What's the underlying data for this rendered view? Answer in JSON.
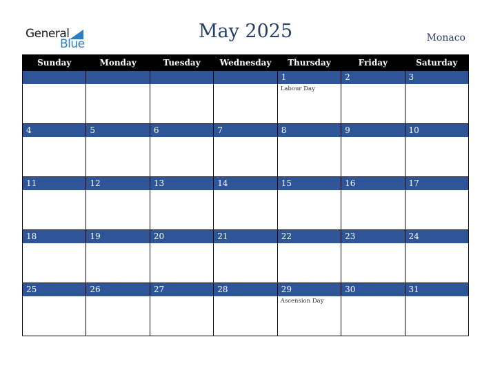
{
  "logo": {
    "word1": "General",
    "word2": "Blue"
  },
  "header": {
    "title": "May 2025",
    "country": "Monaco"
  },
  "colors": {
    "accent": "#2e5597",
    "header_bg": "#000000",
    "title": "#253f6b",
    "logo_blue": "#2a7ec3"
  },
  "weekdays": [
    "Sunday",
    "Monday",
    "Tuesday",
    "Wednesday",
    "Thursday",
    "Friday",
    "Saturday"
  ],
  "weeks": [
    [
      {
        "day": "",
        "holiday": ""
      },
      {
        "day": "",
        "holiday": ""
      },
      {
        "day": "",
        "holiday": ""
      },
      {
        "day": "",
        "holiday": ""
      },
      {
        "day": "1",
        "holiday": "Labour Day"
      },
      {
        "day": "2",
        "holiday": ""
      },
      {
        "day": "3",
        "holiday": ""
      }
    ],
    [
      {
        "day": "4",
        "holiday": ""
      },
      {
        "day": "5",
        "holiday": ""
      },
      {
        "day": "6",
        "holiday": ""
      },
      {
        "day": "7",
        "holiday": ""
      },
      {
        "day": "8",
        "holiday": ""
      },
      {
        "day": "9",
        "holiday": ""
      },
      {
        "day": "10",
        "holiday": ""
      }
    ],
    [
      {
        "day": "11",
        "holiday": ""
      },
      {
        "day": "12",
        "holiday": ""
      },
      {
        "day": "13",
        "holiday": ""
      },
      {
        "day": "14",
        "holiday": ""
      },
      {
        "day": "15",
        "holiday": ""
      },
      {
        "day": "16",
        "holiday": ""
      },
      {
        "day": "17",
        "holiday": ""
      }
    ],
    [
      {
        "day": "18",
        "holiday": ""
      },
      {
        "day": "19",
        "holiday": ""
      },
      {
        "day": "20",
        "holiday": ""
      },
      {
        "day": "21",
        "holiday": ""
      },
      {
        "day": "22",
        "holiday": ""
      },
      {
        "day": "23",
        "holiday": ""
      },
      {
        "day": "24",
        "holiday": ""
      }
    ],
    [
      {
        "day": "25",
        "holiday": ""
      },
      {
        "day": "26",
        "holiday": ""
      },
      {
        "day": "27",
        "holiday": ""
      },
      {
        "day": "28",
        "holiday": ""
      },
      {
        "day": "29",
        "holiday": "Ascension Day"
      },
      {
        "day": "30",
        "holiday": ""
      },
      {
        "day": "31",
        "holiday": ""
      }
    ]
  ]
}
